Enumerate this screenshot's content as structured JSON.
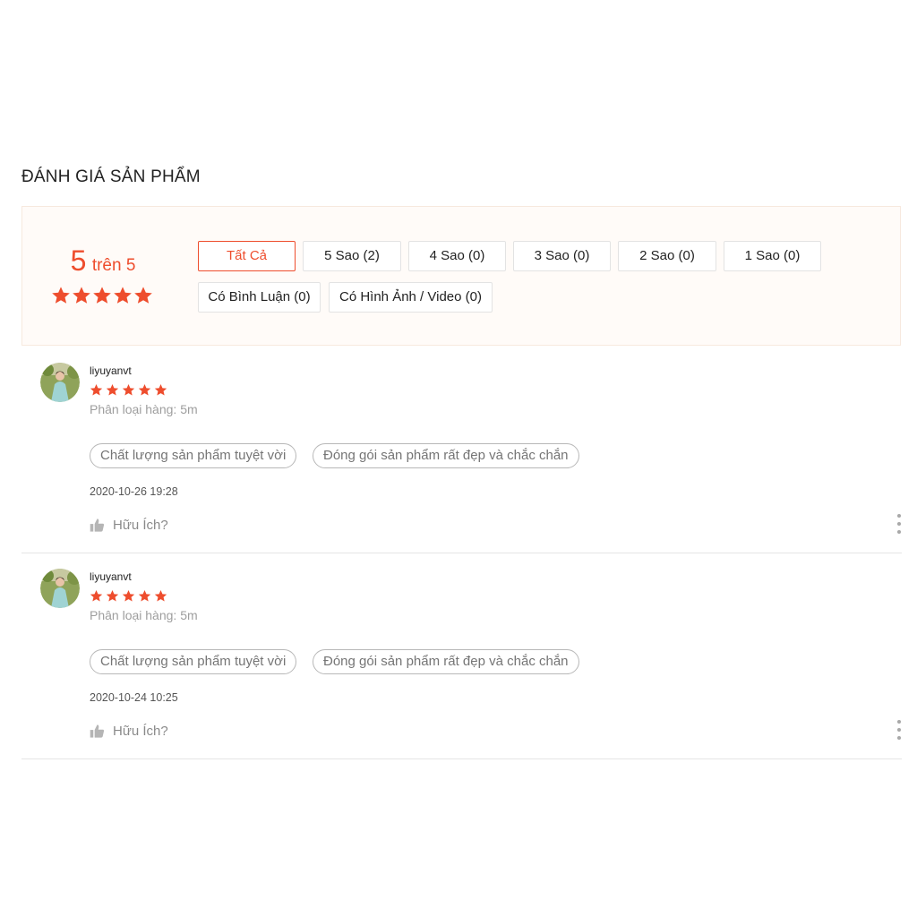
{
  "section_title": "ĐÁNH GIÁ SẢN PHẨM",
  "overview": {
    "score": "5",
    "score_suffix": "trên 5",
    "rating_stars": 5,
    "filters": [
      {
        "label": "Tất Cả",
        "active": true
      },
      {
        "label": "5 Sao (2)",
        "active": false
      },
      {
        "label": "4 Sao (0)",
        "active": false
      },
      {
        "label": "3 Sao (0)",
        "active": false
      },
      {
        "label": "2 Sao (0)",
        "active": false
      },
      {
        "label": "1 Sao (0)",
        "active": false
      },
      {
        "label": "Có Bình Luận (0)",
        "active": false
      },
      {
        "label": "Có Hình Ảnh / Video (0)",
        "active": false
      }
    ]
  },
  "reviews": [
    {
      "username": "liyuyanvt",
      "rating": 5,
      "variation": "Phân loại hàng: 5m",
      "tags": [
        "Chất lượng sản phẩm tuyệt vời",
        "Đóng gói sản phẩm rất đẹp và chắc chắn"
      ],
      "timestamp": "2020-10-26 19:28",
      "helpful_label": "Hữu Ích?"
    },
    {
      "username": "liyuyanvt",
      "rating": 5,
      "variation": "Phân loại hàng: 5m",
      "tags": [
        "Chất lượng sản phẩm tuyệt vời",
        "Đóng gói sản phẩm rất đẹp và chắc chắn"
      ],
      "timestamp": "2020-10-24 10:25",
      "helpful_label": "Hữu Ích?"
    }
  ],
  "colors": {
    "accent": "#ee4d2d",
    "overview_bg": "#fffbf8",
    "muted_text": "#9e9e9e"
  },
  "icons": {
    "star": "star-icon",
    "helpful": "thumbs-up-icon",
    "more": "more-vertical-icon",
    "avatar": "user-avatar"
  }
}
